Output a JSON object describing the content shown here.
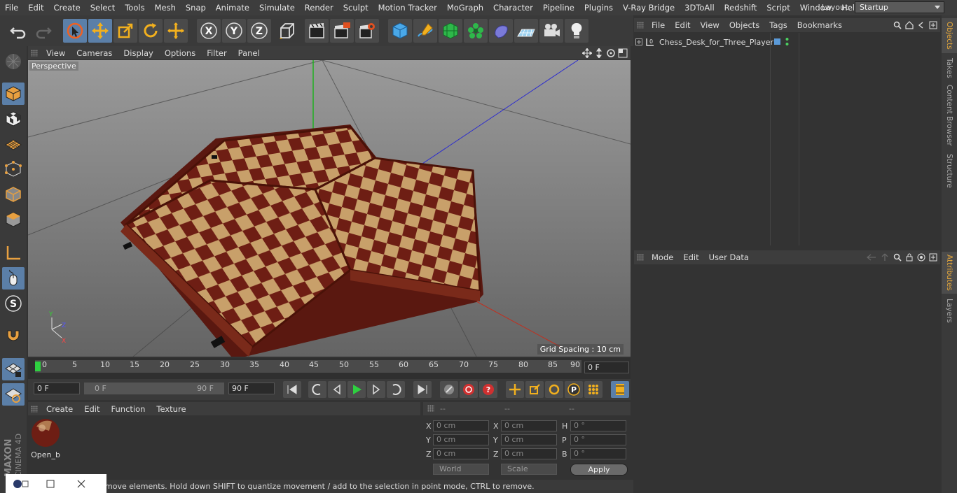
{
  "menubar": {
    "items": [
      "File",
      "Edit",
      "Create",
      "Select",
      "Tools",
      "Mesh",
      "Snap",
      "Animate",
      "Simulate",
      "Render",
      "Sculpt",
      "Motion Tracker",
      "MoGraph",
      "Character",
      "Pipeline",
      "Plugins",
      "V-Ray Bridge",
      "3DToAll",
      "Redshift",
      "Script",
      "Window",
      "Help"
    ],
    "layout_label": "Layout:",
    "layout_value": "Startup"
  },
  "toolbar": {
    "icons": [
      "undo-icon",
      "redo-icon",
      "live-selection-icon",
      "move-icon",
      "scale-icon",
      "rotate-icon",
      "transform-icon",
      "x-axis-icon",
      "y-axis-icon",
      "z-axis-icon",
      "coordinate-system-icon",
      "render-view-icon",
      "render-picture-viewer-icon",
      "render-settings-icon",
      "cube-icon",
      "pen-icon",
      "subdivision-icon",
      "cloner-icon",
      "deformer-icon",
      "floor-icon",
      "camera-icon",
      "light-icon"
    ]
  },
  "viewport": {
    "menu": [
      "View",
      "Cameras",
      "Display",
      "Options",
      "Filter",
      "Panel"
    ],
    "label": "Perspective",
    "grid_spacing": "Grid Spacing : 10 cm"
  },
  "timeline": {
    "ticks": [
      "0",
      "5",
      "10",
      "15",
      "20",
      "25",
      "30",
      "35",
      "40",
      "45",
      "50",
      "55",
      "60",
      "65",
      "70",
      "75",
      "80",
      "85",
      "90"
    ],
    "current_frame": "0 F"
  },
  "transport": {
    "start_field": "0 F",
    "range_start": "0 F",
    "range_end": "90 F",
    "end_field": "90 F"
  },
  "material": {
    "menu": [
      "Create",
      "Edit",
      "Function",
      "Texture"
    ],
    "items": [
      {
        "name": "Open_b"
      }
    ]
  },
  "coordinates": {
    "headers": [
      "--",
      "--",
      "--"
    ],
    "rows": [
      {
        "l1": "X",
        "v1": "0 cm",
        "l2": "X",
        "v2": "0 cm",
        "l3": "H",
        "v3": "0 °"
      },
      {
        "l1": "Y",
        "v1": "0 cm",
        "l2": "Y",
        "v2": "0 cm",
        "l3": "P",
        "v3": "0 °"
      },
      {
        "l1": "Z",
        "v1": "0 cm",
        "l2": "Z",
        "v2": "0 cm",
        "l3": "B",
        "v3": "0 °"
      }
    ],
    "mode_dropdown": "World",
    "scale_dropdown": "Scale",
    "apply_label": "Apply"
  },
  "objects": {
    "menu": [
      "File",
      "Edit",
      "View",
      "Objects",
      "Tags",
      "Bookmarks"
    ],
    "items": [
      {
        "name": "Chess_Desk_for_Three_Players"
      }
    ]
  },
  "attributes": {
    "menu": [
      "Mode",
      "Edit",
      "User Data"
    ]
  },
  "righttabs": [
    "Objects",
    "Takes",
    "Content Browser",
    "Structure",
    "Attributes",
    "Layers"
  ],
  "status": "move elements. Hold down SHIFT to quantize movement / add to the selection in point mode, CTRL to remove.",
  "brand": {
    "line1": "MAXON",
    "line2": "CINEMA 4D"
  },
  "colors": {
    "accent": "#5b7fa8",
    "board_dark": "#6e1e14",
    "board_light": "#c8a06a"
  }
}
